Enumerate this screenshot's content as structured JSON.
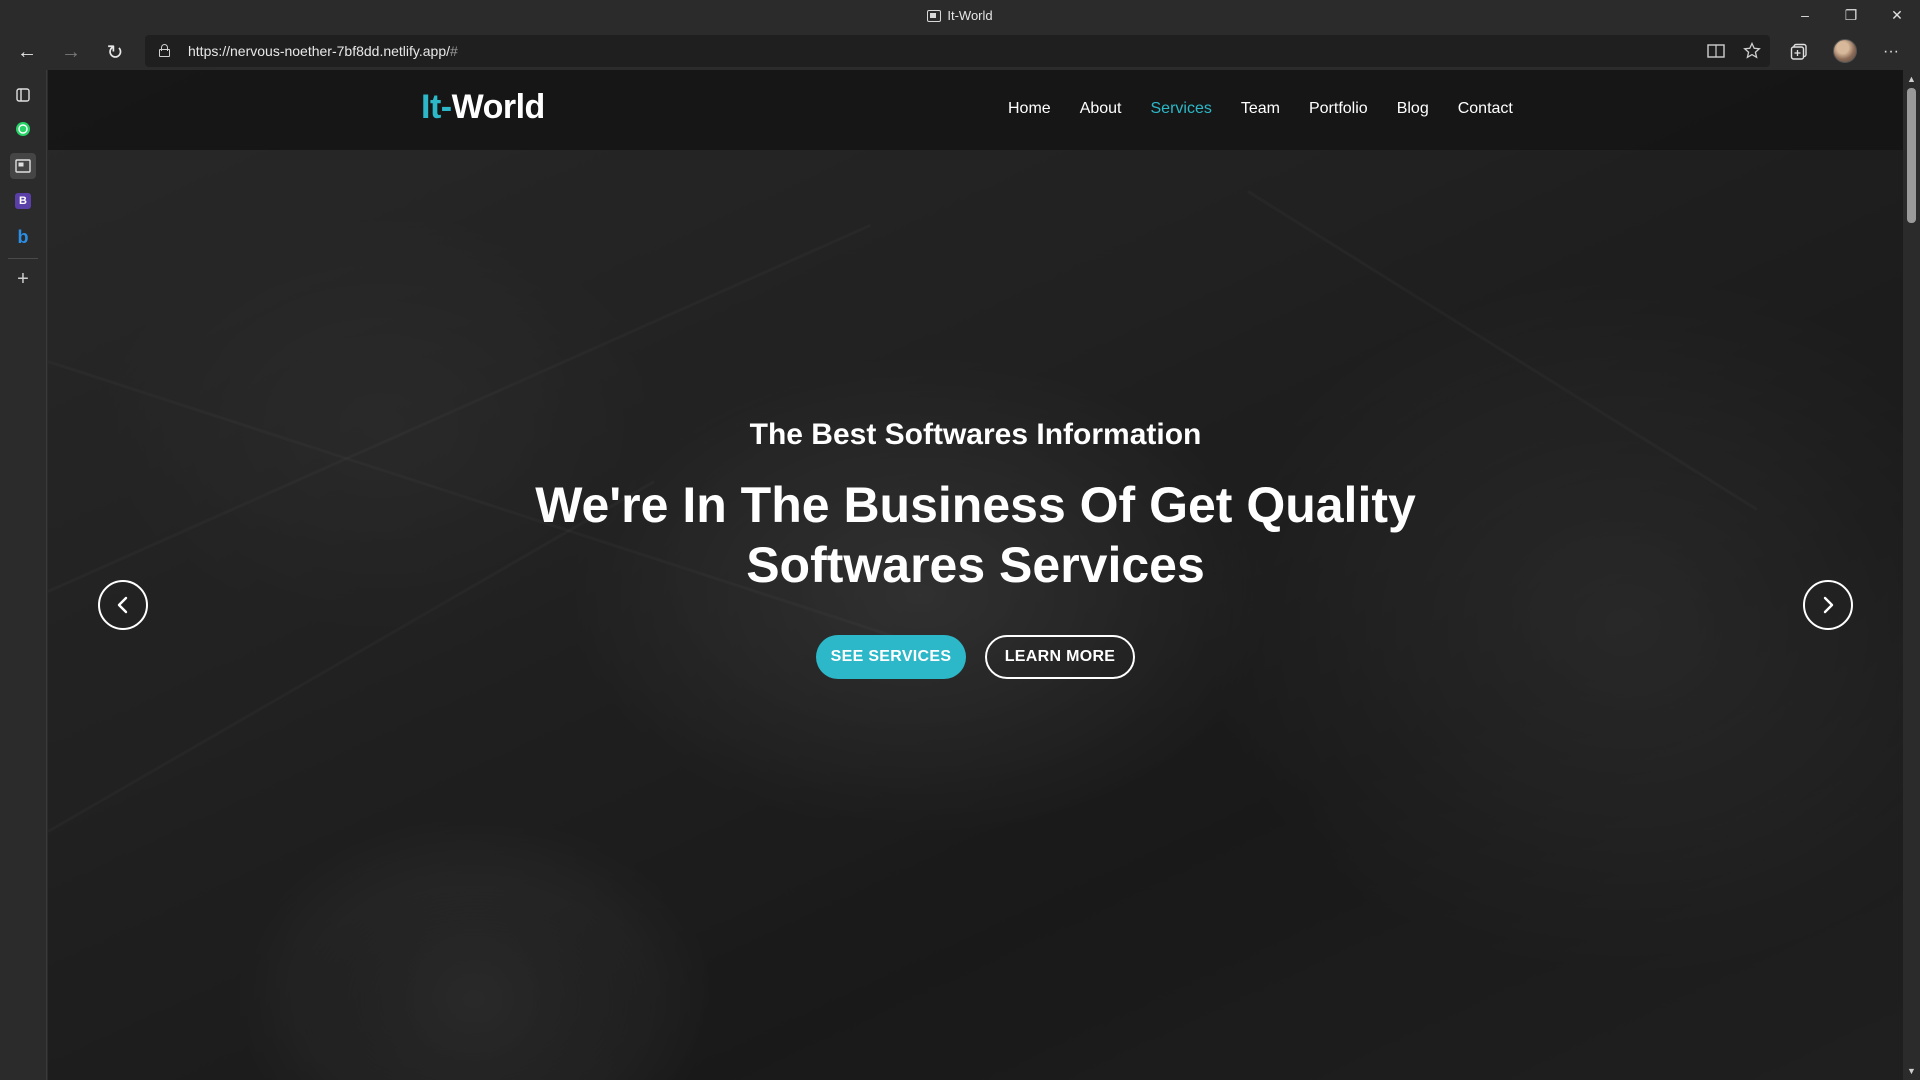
{
  "window": {
    "title": "It-World",
    "controls": {
      "minimize": "–",
      "restore": "❐",
      "close": "✕"
    }
  },
  "toolbar": {
    "back": "←",
    "forward": "→",
    "refresh": "↻",
    "url_main": "https://nervous-noether-7bf8dd.netlify.app/",
    "url_hash": "#",
    "icons": [
      "reader-mode-icon",
      "favorites-icon",
      "collections-icon",
      "profile-avatar",
      "more-icon"
    ],
    "more": "···"
  },
  "sidebar": {
    "items": [
      "tabs-icon",
      "whatsapp-icon",
      "page-icon",
      "b-app-icon",
      "bing-icon",
      "add-icon"
    ],
    "b_label": "B",
    "bing_label": "b",
    "add_label": "+"
  },
  "site": {
    "logo_accent": "It-",
    "logo_main": "World",
    "nav": [
      "Home",
      "About",
      "Services",
      "Team",
      "Portfolio",
      "Blog",
      "Contact"
    ],
    "active_nav": "Services",
    "accent_color": "#2cb8c8"
  },
  "hero": {
    "subtitle": "The Best Softwares Information",
    "title_line1": "We're In The Business Of Get Quality",
    "title_line2": "Softwares Services",
    "primary_button": "SEE SERVICES",
    "secondary_button": "LEARN MORE",
    "prev": "‹",
    "next": "›"
  }
}
